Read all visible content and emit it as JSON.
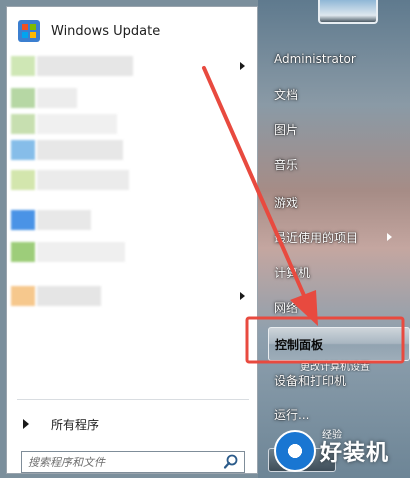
{
  "start_menu": {
    "pinned": {
      "label": "Windows Update",
      "icon": "windows-update-icon"
    },
    "all_programs": "所有程序",
    "search": {
      "placeholder": "搜索程序和文件"
    },
    "right_items": [
      {
        "label": "Administrator",
        "type": "user"
      },
      {
        "label": "文档"
      },
      {
        "label": "图片"
      },
      {
        "label": "音乐"
      },
      {
        "label": "游戏"
      },
      {
        "label": "最近使用的项目",
        "submenu": true
      },
      {
        "label": "计算机"
      },
      {
        "label": "网络"
      },
      {
        "label": "控制面板",
        "highlighted": true
      },
      {
        "label": "设备和打印机"
      },
      {
        "label": "运行..."
      }
    ],
    "tooltip": "更改计算机设置"
  },
  "watermark": {
    "text": "好装机",
    "small": "经验"
  },
  "colors": {
    "annotation_red": "#e84a3f",
    "left_bg": "#ffffff",
    "highlight_border": "#e9edf0"
  }
}
